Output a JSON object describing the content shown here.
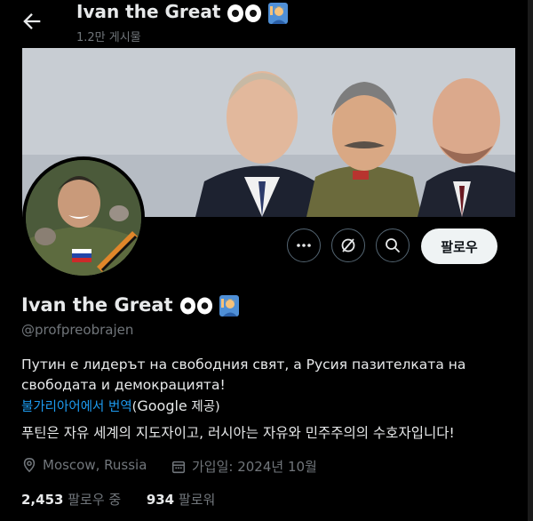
{
  "header": {
    "title": "Ivan the Great",
    "post_count": "1.2만 게시물"
  },
  "actions": {
    "follow_label": "팔로우",
    "more_icon": "more-icon",
    "grok_icon": "grok-icon",
    "search_icon": "search-icon"
  },
  "profile": {
    "name": "Ivan the Great",
    "handle": "@profpreobrajen",
    "bio": "Путин е лидерът на свободния свят, а Русия пазителката на свободата и демокрацията!",
    "translate_link": "불가리아어에서 번역",
    "translate_by_prefix": "(",
    "translate_by_google": "Google",
    "translate_by_suffix": " 제공)",
    "translated_bio": "푸틴은 자유 세계의 지도자이고, 러시아는 자유와 민주주의의 수호자입니다!",
    "location": "Moscow, Russia",
    "joined": "가입일: 2024년 10월",
    "following_count": "2,453",
    "following_label": "팔로우 중",
    "followers_count": "934",
    "followers_label": "팔로워"
  },
  "colors": {
    "background": "#000000",
    "text": "#e7e9ea",
    "muted": "#71767b",
    "link": "#1d9bf0"
  }
}
